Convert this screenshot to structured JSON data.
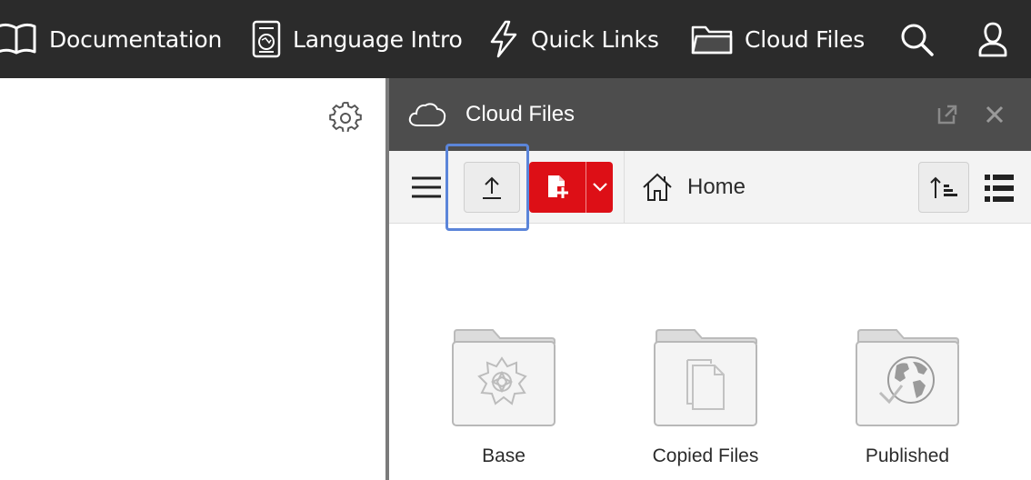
{
  "nav": {
    "items": [
      {
        "label": "Documentation",
        "icon": "book-icon"
      },
      {
        "label": "Language Intro",
        "icon": "guide-icon"
      },
      {
        "label": "Quick Links",
        "icon": "lightning-icon"
      },
      {
        "label": "Cloud Files",
        "icon": "folder-icon"
      }
    ],
    "search_icon": "search-icon",
    "user_icon": "user-icon"
  },
  "left_pane": {
    "settings_icon": "gear-icon"
  },
  "panel": {
    "title": "Cloud Files",
    "icon": "cloud-icon",
    "popout_icon": "popout-icon",
    "close_icon": "close-icon"
  },
  "toolbar": {
    "menu_icon": "hamburger-icon",
    "upload_icon": "upload-icon",
    "new_file_icon": "new-file-icon",
    "dropdown_icon": "chevron-down-icon",
    "breadcrumb_home": "Home",
    "sort_icon": "sort-icon",
    "view_icon": "list-view-icon"
  },
  "folders": [
    {
      "label": "Base",
      "icon": "wolfram-spikey-icon"
    },
    {
      "label": "Copied Files",
      "icon": "copy-icon"
    },
    {
      "label": "Published",
      "icon": "globe-check-icon"
    }
  ],
  "colors": {
    "topbar": "#2b2b2b",
    "panel_header": "#4d4d4d",
    "accent_red": "#dd0f16",
    "focus_blue": "#5b85d9"
  }
}
